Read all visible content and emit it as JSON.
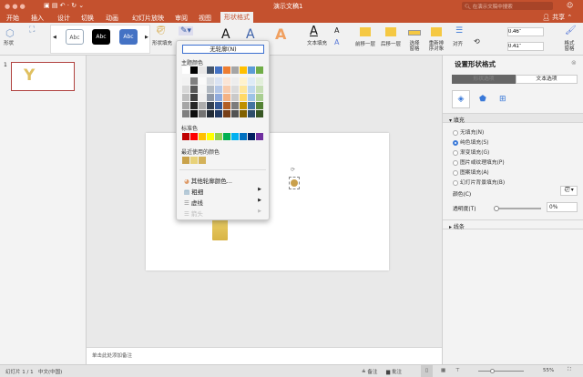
{
  "window": {
    "title": "演示文稿1",
    "search_placeholder": "在演示文稿中搜索",
    "share": "共享"
  },
  "tabs": [
    "开始",
    "插入",
    "设计",
    "切换",
    "动画",
    "幻灯片放映",
    "审阅",
    "视图",
    "形状格式"
  ],
  "active_tab": "形状格式",
  "ribbon": {
    "shape": "形状",
    "style_samples": [
      "Abc",
      "Abc",
      "Abc"
    ],
    "shape_fill": "形状填充",
    "text_fill": "文本填充",
    "bring_forward": "前移一层",
    "send_backward": "后移一层",
    "selection_pane": "选择窗格",
    "reorder": "重新排序对象",
    "align": "对齐",
    "height": "0.46\"",
    "width": "0.41\"",
    "format_pane": "格式窗格"
  },
  "menu": {
    "no_outline": "无轮廓(N)",
    "theme_colors_label": "主题颜色",
    "standard_colors_label": "标准色",
    "recent_colors_label": "最近使用的颜色",
    "more_colors": "其他轮廓颜色...",
    "weight": "粗细",
    "dashes": "虚线",
    "arrows": "箭头",
    "theme_colors": [
      "#ffffff",
      "#000000",
      "#e7e6e6",
      "#44546a",
      "#4472c4",
      "#ed7d31",
      "#a5a5a5",
      "#ffc000",
      "#5b9bd5",
      "#70ad47"
    ],
    "standard_colors": [
      "#c00000",
      "#ff0000",
      "#ffc000",
      "#ffff00",
      "#92d050",
      "#00b050",
      "#00b0f0",
      "#0070c0",
      "#002060",
      "#7030a0"
    ],
    "recent_colors": [
      "#c9a24a",
      "#e8d27a",
      "#d4b25a"
    ]
  },
  "slides": {
    "number": "1"
  },
  "notes_placeholder": "单击此处添加备注",
  "pane": {
    "title": "设置形状格式",
    "tab_shape": "形状选项",
    "tab_text": "文本选项",
    "fill_section": "填充",
    "fill_options": [
      "无填充(N)",
      "纯色填充(S)",
      "渐变填充(G)",
      "图片或纹理填充(P)",
      "图案填充(A)",
      "幻灯片背景填充(B)"
    ],
    "selected_fill": "纯色填充(S)",
    "color_label": "颜色(C)",
    "transparency_label": "透明度(T)",
    "transparency_value": "0%",
    "line_section": "线条"
  },
  "status": {
    "slide": "幻灯片 1 / 1",
    "language": "中文(中国)",
    "notes": "备注",
    "comments": "批注",
    "zoom": "55%"
  },
  "colors": {
    "accent": "#c4512e",
    "shape": "#e8c865"
  }
}
